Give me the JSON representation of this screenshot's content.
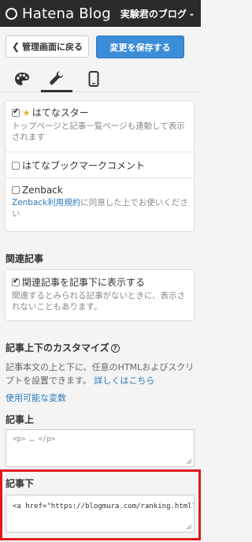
{
  "header": {
    "logo_text": "Hatena Blog",
    "blog_name": "実験君のブログ - "
  },
  "buttons": {
    "back_label": "管理画面に戻る",
    "save_label": "変更を保存する"
  },
  "tabs": [
    {
      "name": "design",
      "icon": "palette-icon"
    },
    {
      "name": "customize",
      "icon": "wrench-icon",
      "active": true
    },
    {
      "name": "smartphone",
      "icon": "smartphone-icon"
    }
  ],
  "share_options": [
    {
      "label": "はてなスター",
      "checked": true,
      "desc": "トップページと記事一覧ページも連動して表示されます"
    },
    {
      "label": "はてなブックマークコメント",
      "checked": false,
      "desc": ""
    },
    {
      "label": "Zenback",
      "checked": false,
      "desc_link": "Zenback利用規約",
      "desc": "に同意した上でお使いください"
    }
  ],
  "related": {
    "title": "関連記事",
    "option_label": "関連記事を記事下に表示する",
    "checked": true,
    "desc": "関連するとみられる記事がないときに、表示されないこともあります。"
  },
  "customize": {
    "title": "記事上下のカスタマイズ",
    "desc": "記事本文の上と下に、任意のHTMLおよびスクリプトを設置できます。",
    "more_link": "詳しくはこちら",
    "variables_link": "使用可能な変数",
    "above_title": "記事上",
    "above_value": "<p> … </p>",
    "below_title": "記事下",
    "below_value": "<a href=\"https://blogmura.com/ranking.html?p_"
  },
  "colors": {
    "topbar": "#2b2b2b",
    "save_button": "#3b8dd8",
    "link": "#2a7ab8",
    "highlight": "#e0191b"
  }
}
